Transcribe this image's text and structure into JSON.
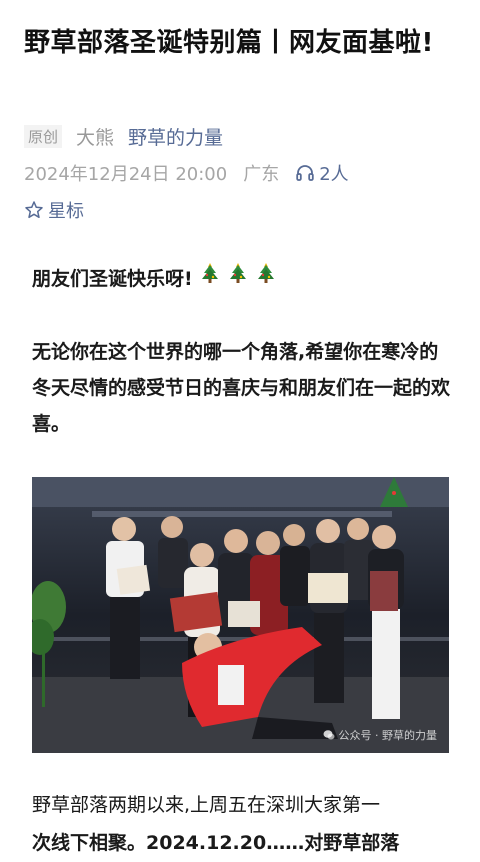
{
  "article": {
    "title": "野草部落圣诞特别篇丨网友面基啦!",
    "original_tag": "原创",
    "author": "大熊",
    "account": "野草的力量",
    "date": "2024年12月24日 20:00",
    "location": "广东",
    "listeners": "2人",
    "star_label": "星标"
  },
  "content": {
    "greeting": "朋友们圣诞快乐呀!",
    "greeting_emoji": "christmas-tree-icon",
    "paragraph": "无论你在这个世界的哪一个角落,希望你在寒冷的冬天尽情的感受节日的喜庆与和朋友们在一起的欢喜。",
    "photo_watermark": "公众号 · 野草的力量",
    "body_line1": "野草部落两期以来,上周五在深圳大家第一",
    "body_line2": "次线下相聚。2024.12.20……对野草部落"
  },
  "colors": {
    "link": "#576b95",
    "meta_gray": "#a6a6a6",
    "text": "#1a1a1a",
    "jacket_red": "#e02a2f"
  }
}
